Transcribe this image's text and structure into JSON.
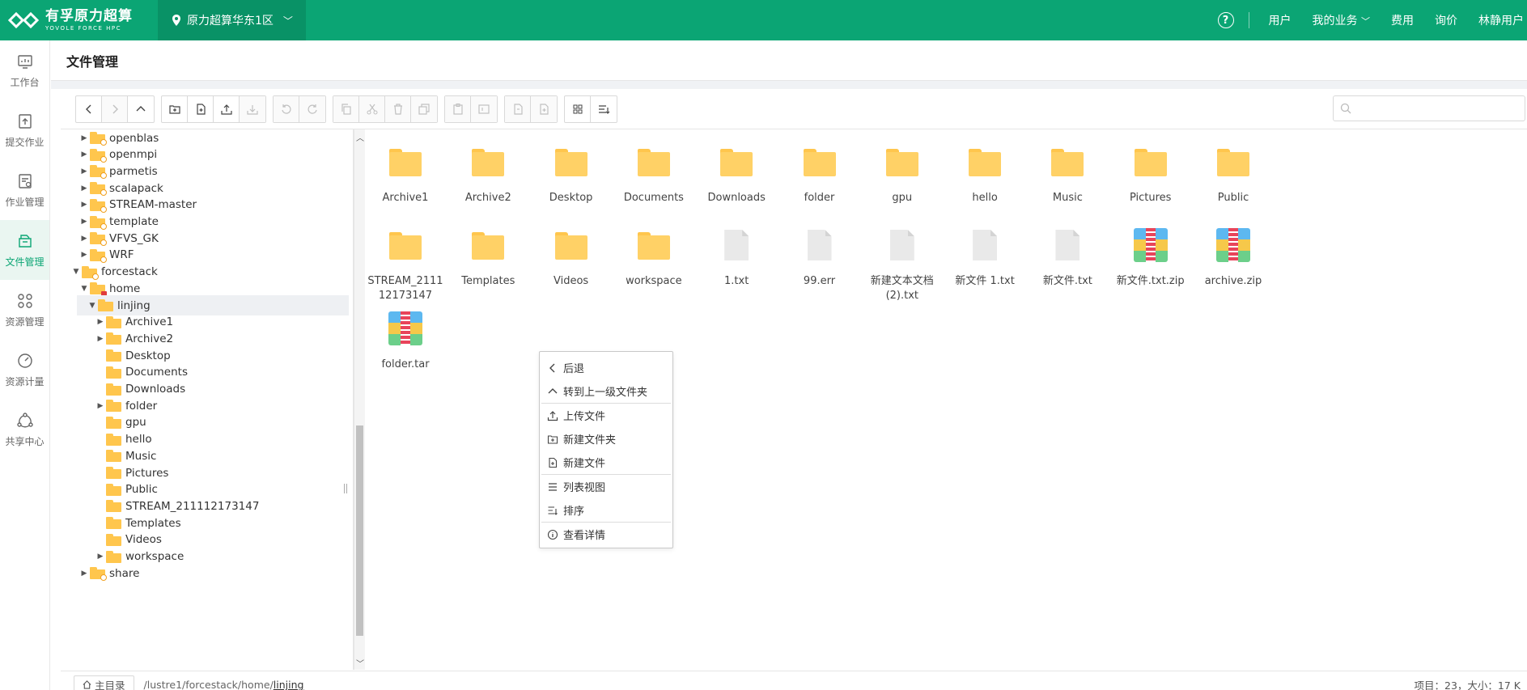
{
  "app": {
    "logo_cn": "有孚原力超算",
    "logo_en": "YOVOLE FORCE HPC",
    "region": "原力超算华东1区",
    "top_links": [
      "用户",
      "我的业务",
      "费用",
      "询价",
      "林静用户"
    ],
    "page_title": "文件管理"
  },
  "rail": [
    {
      "label": "工作台",
      "icon": "dashboard-icon",
      "active": false
    },
    {
      "label": "提交作业",
      "icon": "submit-job-icon",
      "active": false
    },
    {
      "label": "作业管理",
      "icon": "job-manage-icon",
      "active": false
    },
    {
      "label": "文件管理",
      "icon": "file-manage-icon",
      "active": true
    },
    {
      "label": "资源管理",
      "icon": "resource-icon",
      "active": false
    },
    {
      "label": "资源计量",
      "icon": "metering-icon",
      "active": false
    },
    {
      "label": "共享中心",
      "icon": "share-center-icon",
      "active": false
    }
  ],
  "search": {
    "placeholder": ""
  },
  "tree": [
    {
      "label": "openblas",
      "depth": 1,
      "expandable": true,
      "badge": "link"
    },
    {
      "label": "openmpi",
      "depth": 1,
      "expandable": true,
      "badge": "link"
    },
    {
      "label": "parmetis",
      "depth": 1,
      "expandable": true,
      "badge": "link"
    },
    {
      "label": "scalapack",
      "depth": 1,
      "expandable": true,
      "badge": "link"
    },
    {
      "label": "STREAM-master",
      "depth": 1,
      "expandable": true,
      "badge": "link"
    },
    {
      "label": "template",
      "depth": 1,
      "expandable": true,
      "badge": "link"
    },
    {
      "label": "VFVS_GK",
      "depth": 1,
      "expandable": true,
      "badge": "link"
    },
    {
      "label": "WRF",
      "depth": 1,
      "expandable": true,
      "badge": "link"
    },
    {
      "label": "forcestack",
      "depth": 0,
      "expandable": true,
      "expanded": true,
      "badge": "link"
    },
    {
      "label": "home",
      "depth": 1,
      "expandable": true,
      "expanded": true,
      "badge": "lock"
    },
    {
      "label": "linjing",
      "depth": 2,
      "expandable": true,
      "expanded": true,
      "selected": true
    },
    {
      "label": "Archive1",
      "depth": 3,
      "expandable": true
    },
    {
      "label": "Archive2",
      "depth": 3,
      "expandable": true
    },
    {
      "label": "Desktop",
      "depth": 3,
      "expandable": false
    },
    {
      "label": "Documents",
      "depth": 3,
      "expandable": false
    },
    {
      "label": "Downloads",
      "depth": 3,
      "expandable": false
    },
    {
      "label": "folder",
      "depth": 3,
      "expandable": true
    },
    {
      "label": "gpu",
      "depth": 3,
      "expandable": false
    },
    {
      "label": "hello",
      "depth": 3,
      "expandable": false
    },
    {
      "label": "Music",
      "depth": 3,
      "expandable": false
    },
    {
      "label": "Pictures",
      "depth": 3,
      "expandable": false
    },
    {
      "label": "Public",
      "depth": 3,
      "expandable": false
    },
    {
      "label": "STREAM_211112173147",
      "depth": 3,
      "expandable": false
    },
    {
      "label": "Templates",
      "depth": 3,
      "expandable": false
    },
    {
      "label": "Videos",
      "depth": 3,
      "expandable": false
    },
    {
      "label": "workspace",
      "depth": 3,
      "expandable": true
    },
    {
      "label": "share",
      "depth": 1,
      "expandable": true,
      "badge": "link"
    }
  ],
  "files": [
    {
      "name": "Archive1",
      "type": "folder"
    },
    {
      "name": "Archive2",
      "type": "folder"
    },
    {
      "name": "Desktop",
      "type": "folder"
    },
    {
      "name": "Documents",
      "type": "folder"
    },
    {
      "name": "Downloads",
      "type": "folder"
    },
    {
      "name": "folder",
      "type": "folder"
    },
    {
      "name": "gpu",
      "type": "folder"
    },
    {
      "name": "hello",
      "type": "folder"
    },
    {
      "name": "Music",
      "type": "folder"
    },
    {
      "name": "Pictures",
      "type": "folder"
    },
    {
      "name": "Public",
      "type": "folder"
    },
    {
      "name": "STREAM_211112173147",
      "type": "folder"
    },
    {
      "name": "Templates",
      "type": "folder"
    },
    {
      "name": "Videos",
      "type": "folder"
    },
    {
      "name": "workspace",
      "type": "folder"
    },
    {
      "name": "1.txt",
      "type": "doc"
    },
    {
      "name": "99.err",
      "type": "doc"
    },
    {
      "name": "新建文本文档(2).txt",
      "type": "doc"
    },
    {
      "name": "新文件 1.txt",
      "type": "doc"
    },
    {
      "name": "新文件.txt",
      "type": "doc"
    },
    {
      "name": "新文件.txt.zip",
      "type": "zip"
    },
    {
      "name": "archive.zip",
      "type": "zip"
    },
    {
      "name": "folder.tar",
      "type": "zip"
    }
  ],
  "context_menu": [
    {
      "label": "后退",
      "icon": "back-icon",
      "sep_after": false
    },
    {
      "label": "转到上一级文件夹",
      "icon": "up-icon",
      "sep_after": true
    },
    {
      "label": "上传文件",
      "icon": "upload-icon",
      "sep_after": false
    },
    {
      "label": "新建文件夹",
      "icon": "new-folder-icon",
      "sep_after": false
    },
    {
      "label": "新建文件",
      "icon": "new-file-icon",
      "sep_after": true
    },
    {
      "label": "列表视图",
      "icon": "list-view-icon",
      "sep_after": false
    },
    {
      "label": "排序",
      "icon": "sort-icon",
      "sep_after": true
    },
    {
      "label": "查看详情",
      "icon": "info-icon",
      "sep_after": false
    }
  ],
  "status": {
    "home_label": "主目录",
    "path_prefix": "/lustre1/forcestack/home/",
    "path_current": "linjing",
    "summary": "项目：23，大小：17 K"
  },
  "colors": {
    "brand": "#0ba574",
    "folder": "#ffc64d"
  }
}
